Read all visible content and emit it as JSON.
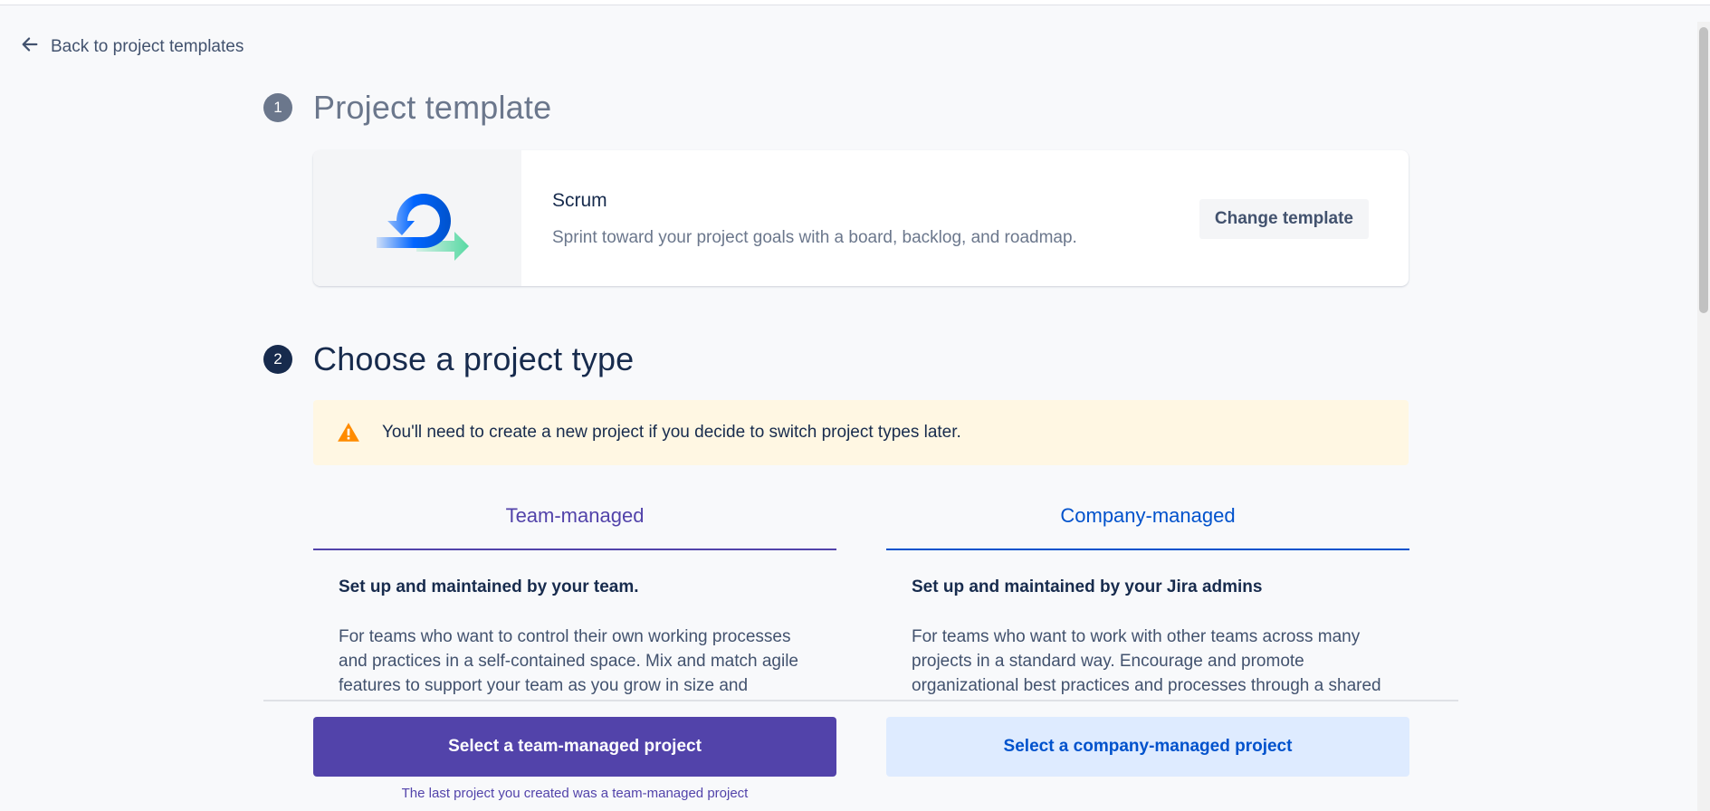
{
  "nav": {
    "back_label": "Back to project templates"
  },
  "step1": {
    "number": "1",
    "title": "Project template",
    "template": {
      "name": "Scrum",
      "description": "Sprint toward your project goals with a board, backlog, and roadmap.",
      "icon": "scrum-cycle-icon",
      "change_label": "Change template"
    }
  },
  "step2": {
    "number": "2",
    "title": "Choose a project type",
    "warning": {
      "icon": "warning-icon",
      "text": "You'll need to create a new project if you decide to switch project types later."
    },
    "types": [
      {
        "title": "Team-managed",
        "subtitle": "Set up and maintained by your team.",
        "description": "For teams who want to control their own working processes and practices in a self-contained space. Mix and match agile features to support your team as you grow in size and",
        "button_label": "Select a team-managed project",
        "note": "The last project you created was a team-managed project",
        "accent": "#5243AA"
      },
      {
        "title": "Company-managed",
        "subtitle": "Set up and maintained by your Jira admins",
        "description": "For teams who want to work with other teams across many projects in a standard way. Encourage and promote organizational best practices and processes through a shared",
        "button_label": "Select a company-managed project",
        "accent": "#0052CC"
      }
    ]
  }
}
